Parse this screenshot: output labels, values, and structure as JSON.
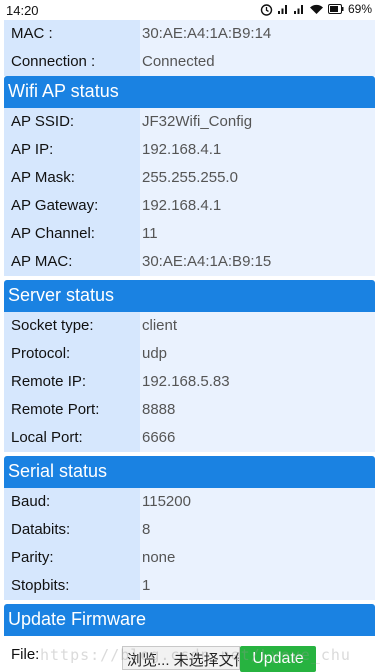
{
  "status_bar": {
    "time": "14:20",
    "battery": "69%"
  },
  "top_rows": [
    {
      "label": "MAC :",
      "value": "30:AE:A4:1A:B9:14"
    },
    {
      "label": "Connection :",
      "value": "Connected"
    }
  ],
  "sections": [
    {
      "title": "Wifi AP status",
      "rows": [
        {
          "label": "AP SSID:",
          "value": "JF32Wifi_Config"
        },
        {
          "label": "AP IP:",
          "value": "192.168.4.1"
        },
        {
          "label": "AP Mask:",
          "value": "255.255.255.0"
        },
        {
          "label": "AP Gateway:",
          "value": "192.168.4.1"
        },
        {
          "label": "AP Channel:",
          "value": "11"
        },
        {
          "label": "AP MAC:",
          "value": "30:AE:A4:1A:B9:15"
        }
      ]
    },
    {
      "title": "Server status",
      "rows": [
        {
          "label": "Socket type:",
          "value": "client"
        },
        {
          "label": "Protocol:",
          "value": "udp"
        },
        {
          "label": "Remote IP:",
          "value": "192.168.5.83"
        },
        {
          "label": "Remote Port:",
          "value": "8888"
        },
        {
          "label": "Local Port:",
          "value": "6666"
        }
      ]
    },
    {
      "title": "Serial status",
      "rows": [
        {
          "label": "Baud:",
          "value": "115200"
        },
        {
          "label": "Databits:",
          "value": "8"
        },
        {
          "label": "Parity:",
          "value": "none"
        },
        {
          "label": "Stopbits:",
          "value": "1"
        }
      ]
    },
    {
      "title": "Update Firmware",
      "rows": []
    }
  ],
  "firmware": {
    "file_label": "File:",
    "browse_label": "浏览... 未选择文件。",
    "update_label": "Update"
  },
  "watermark": "https://blog.csdn.net/Lyoye_chu",
  "colors": {
    "header_blue": "#1a82e2",
    "label_bg": "#d6e7fd",
    "value_bg": "#eaf2fe",
    "update_green": "#27b340"
  }
}
